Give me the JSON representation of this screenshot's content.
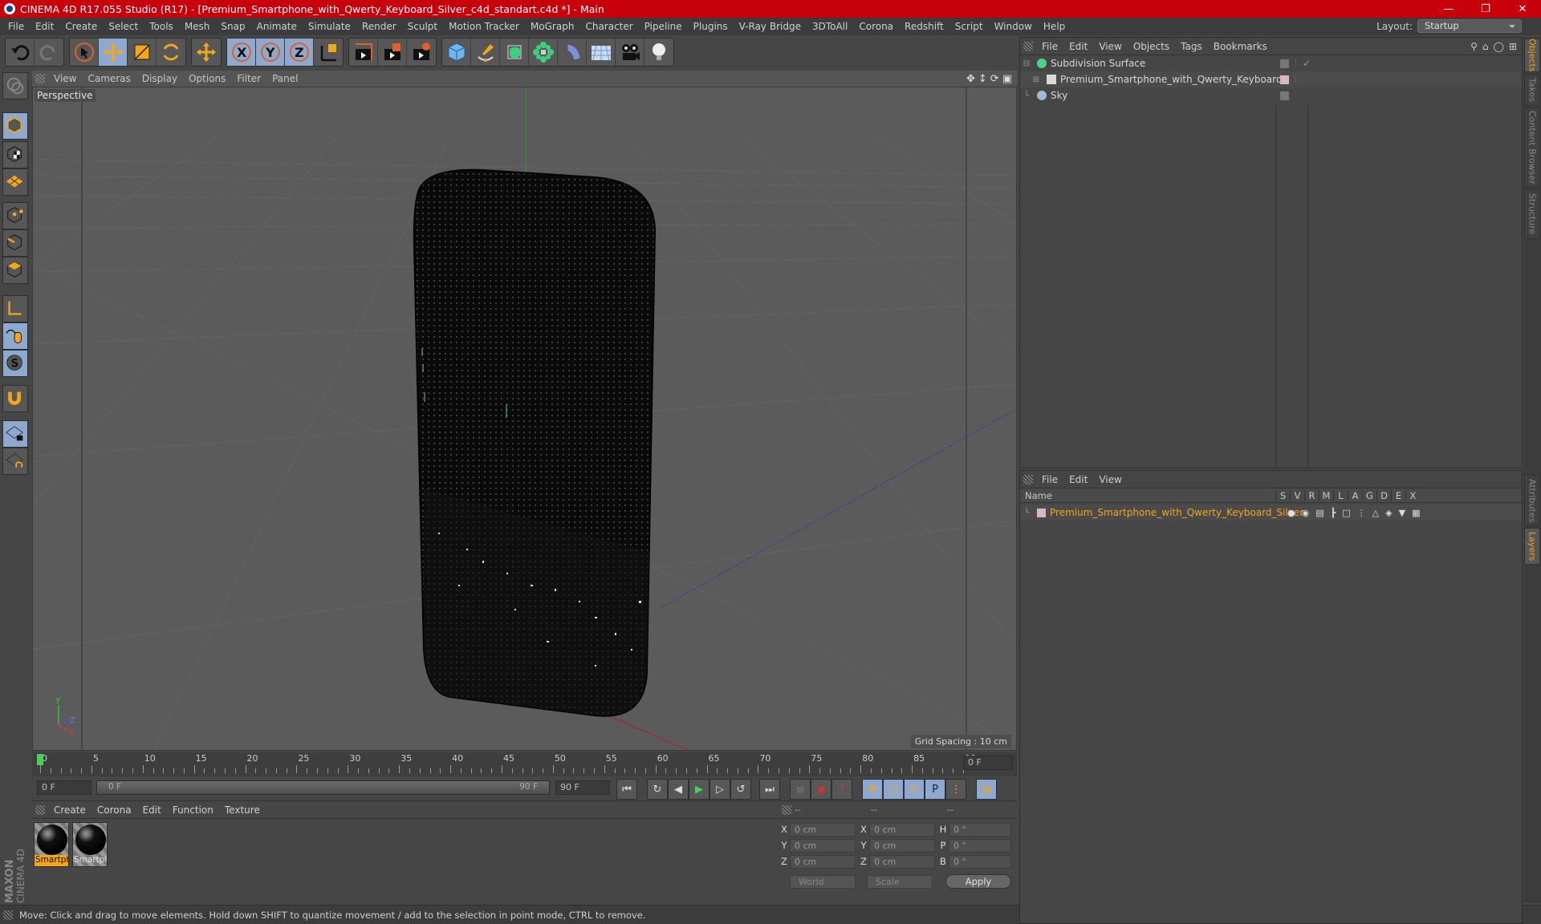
{
  "window": {
    "title": "CINEMA 4D R17.055 Studio (R17) - [Premium_Smartphone_with_Qwerty_Keyboard_Silver_c4d_standart.c4d *] - Main",
    "controls": [
      "minimize",
      "maximize",
      "close"
    ]
  },
  "menubar": {
    "items": [
      "File",
      "Edit",
      "Create",
      "Select",
      "Tools",
      "Mesh",
      "Snap",
      "Animate",
      "Simulate",
      "Render",
      "Sculpt",
      "Motion Tracker",
      "MoGraph",
      "Character",
      "Pipeline",
      "Plugins",
      "V-Ray Bridge",
      "3DToAll",
      "Corona",
      "Redshift",
      "Script",
      "Window",
      "Help"
    ],
    "layout_label": "Layout:",
    "layout_value": "Startup"
  },
  "toolbar": {
    "groups": [
      [
        "undo-icon",
        "redo-icon"
      ],
      [
        "select-icon",
        "move-icon",
        "scale-icon",
        "rotate-icon"
      ],
      [
        "move-alt-icon"
      ],
      [
        "x-axis-icon",
        "y-axis-icon",
        "z-axis-icon",
        "coordinate-system-icon"
      ],
      [
        "render-view-icon",
        "render-picture-viewer-icon",
        "render-settings-icon"
      ],
      [
        "cube-icon",
        "pen-spline-icon",
        "subdivision-icon",
        "cloner-icon",
        "bend-deformer-icon",
        "floor-icon",
        "camera-icon",
        "light-icon"
      ]
    ],
    "active": [
      "move-icon",
      "x-axis-icon",
      "y-axis-icon",
      "z-axis-icon"
    ]
  },
  "left_tools": {
    "items": [
      "make-editable-icon",
      "model-mode-icon",
      "texture-mode-icon",
      "workplane-mode-icon",
      "points-mode-icon",
      "edges-mode-icon",
      "polygons-mode-icon",
      "axis-mode-icon",
      "tweak-mode-icon",
      "solo-icon",
      "snap-magnet-icon",
      "workplane-lock-icon",
      "workplane-align-icon"
    ],
    "active": [
      "model-mode-icon",
      "tweak-mode-icon",
      "solo-icon",
      "workplane-lock-icon"
    ]
  },
  "viewport": {
    "menu": [
      "View",
      "Cameras",
      "Display",
      "Options",
      "Filter",
      "Panel"
    ],
    "camera_label": "Perspective",
    "grid_spacing": "Grid Spacing : 10 cm",
    "nav_icons": [
      "move-view-icon",
      "zoom-view-icon",
      "rotate-view-icon",
      "maximize-view-icon"
    ],
    "axis_labels": [
      "Y",
      "Z",
      "X"
    ]
  },
  "timeline": {
    "ticks": [
      "0",
      "5",
      "10",
      "15",
      "20",
      "25",
      "30",
      "35",
      "40",
      "45",
      "50",
      "55",
      "60",
      "65",
      "70",
      "75",
      "80",
      "85",
      "90"
    ],
    "current_frame": "0 F",
    "start_field": "0 F",
    "range_start": "0 F",
    "range_end": "90 F",
    "end_field": "90 F",
    "playhead_frame": 0
  },
  "playback": {
    "buttons": [
      "go-to-start-icon",
      "previous-key-icon",
      "previous-frame-icon",
      "play-icon",
      "next-frame-icon",
      "next-key-icon",
      "go-to-end-icon",
      "record-disabled-icon",
      "autokey-icon",
      "keyframe-help-icon",
      "key-move-icon",
      "key-scale-icon",
      "key-rotate-icon",
      "key-param-icon",
      "key-pla-icon",
      "timeline-icon"
    ]
  },
  "material_manager": {
    "menu": [
      "Create",
      "Corona",
      "Edit",
      "Function",
      "Texture"
    ],
    "materials": [
      {
        "label": "Smartph",
        "selected": true
      },
      {
        "label": "Smartph",
        "selected": false
      }
    ]
  },
  "coordinates": {
    "headers": [
      "--",
      "--",
      "--"
    ],
    "rows": [
      {
        "a": "X",
        "av": "0 cm",
        "b": "X",
        "bv": "0 cm",
        "c": "H",
        "cv": "0 °"
      },
      {
        "a": "Y",
        "av": "0 cm",
        "b": "Y",
        "bv": "0 cm",
        "c": "P",
        "cv": "0 °"
      },
      {
        "a": "Z",
        "av": "0 cm",
        "b": "Z",
        "bv": "0 cm",
        "c": "B",
        "cv": "0 °"
      }
    ],
    "space": "World",
    "mode": "Scale",
    "apply": "Apply"
  },
  "objects_panel": {
    "menu": [
      "File",
      "Edit",
      "View",
      "Objects",
      "Tags",
      "Bookmarks"
    ],
    "objects": [
      {
        "name": "Subdivision Surface",
        "icon": "subdivision-icon",
        "color": "#4fd18b"
      },
      {
        "name": "Premium_Smartphone_with_Qwerty_Keyboard_Silver",
        "icon": "null-object-icon",
        "color": "#d9d9d9"
      },
      {
        "name": "Sky",
        "icon": "sky-icon",
        "color": "#9fb8d8"
      }
    ]
  },
  "layers_panel": {
    "menu": [
      "File",
      "Edit",
      "View"
    ],
    "columns": [
      "Name",
      "S",
      "V",
      "R",
      "M",
      "L",
      "A",
      "G",
      "D",
      "E",
      "X"
    ],
    "layers": [
      {
        "name": "Premium_Smartphone_with_Qwerty_Keyboard_Silver",
        "color": "#f3a51c"
      }
    ]
  },
  "side_tabs": {
    "top": [
      "Objects",
      "Takes",
      "Content Browser",
      "Structure"
    ],
    "bottom": [
      "Attributes",
      "Layers"
    ],
    "active": [
      "Objects",
      "Layers"
    ]
  },
  "branding": {
    "maxon": "MAXON",
    "product": "CINEMA 4D"
  },
  "status": {
    "text": "Move: Click and drag to move elements. Hold down SHIFT to quantize movement / add to the selection in point mode, CTRL to remove."
  },
  "colors": {
    "accent": "#f3a51c",
    "title_bar": "#c8000b",
    "active_tool": "#8ea9cf"
  }
}
